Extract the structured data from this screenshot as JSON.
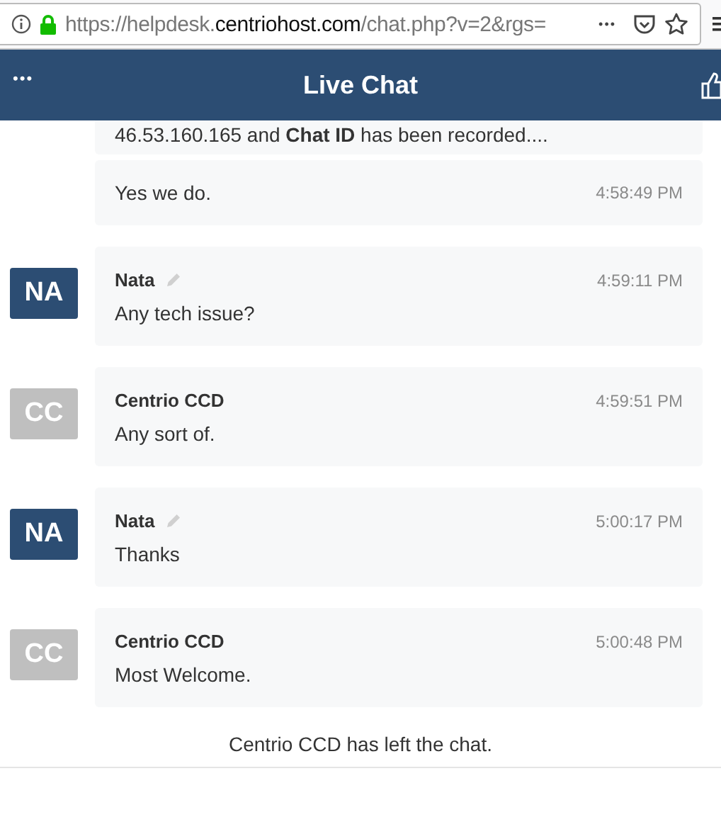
{
  "browser": {
    "url_prefix": "https://helpdesk.",
    "url_domain": "centriohost.com",
    "url_path": "/chat.php?v=2&rgs=",
    "more": "•••"
  },
  "header": {
    "title": "Live Chat",
    "menu": "•••"
  },
  "messages": [
    {
      "kind": "continuation",
      "text": "46.53.160.165 and **Chat ID** has been recorded...."
    },
    {
      "kind": "continuation",
      "text": "Yes we do.",
      "time": "4:58:49 PM"
    },
    {
      "kind": "message",
      "initials": "NA",
      "color": "#2c4d73",
      "name": "Nata",
      "editable": true,
      "time": "4:59:11 PM",
      "text": "Any tech issue?"
    },
    {
      "kind": "message",
      "initials": "CC",
      "color": "#bfbfbf",
      "name": "Centrio CCD",
      "editable": false,
      "time": "4:59:51 PM",
      "text": "Any sort of."
    },
    {
      "kind": "message",
      "initials": "NA",
      "color": "#2c4d73",
      "name": "Nata",
      "editable": true,
      "time": "5:00:17 PM",
      "text": "Thanks"
    },
    {
      "kind": "message",
      "initials": "CC",
      "color": "#bfbfbf",
      "name": "Centrio CCD",
      "editable": false,
      "time": "5:00:48 PM",
      "text": "Most Welcome."
    }
  ],
  "system_note": "Centrio CCD has left the chat."
}
